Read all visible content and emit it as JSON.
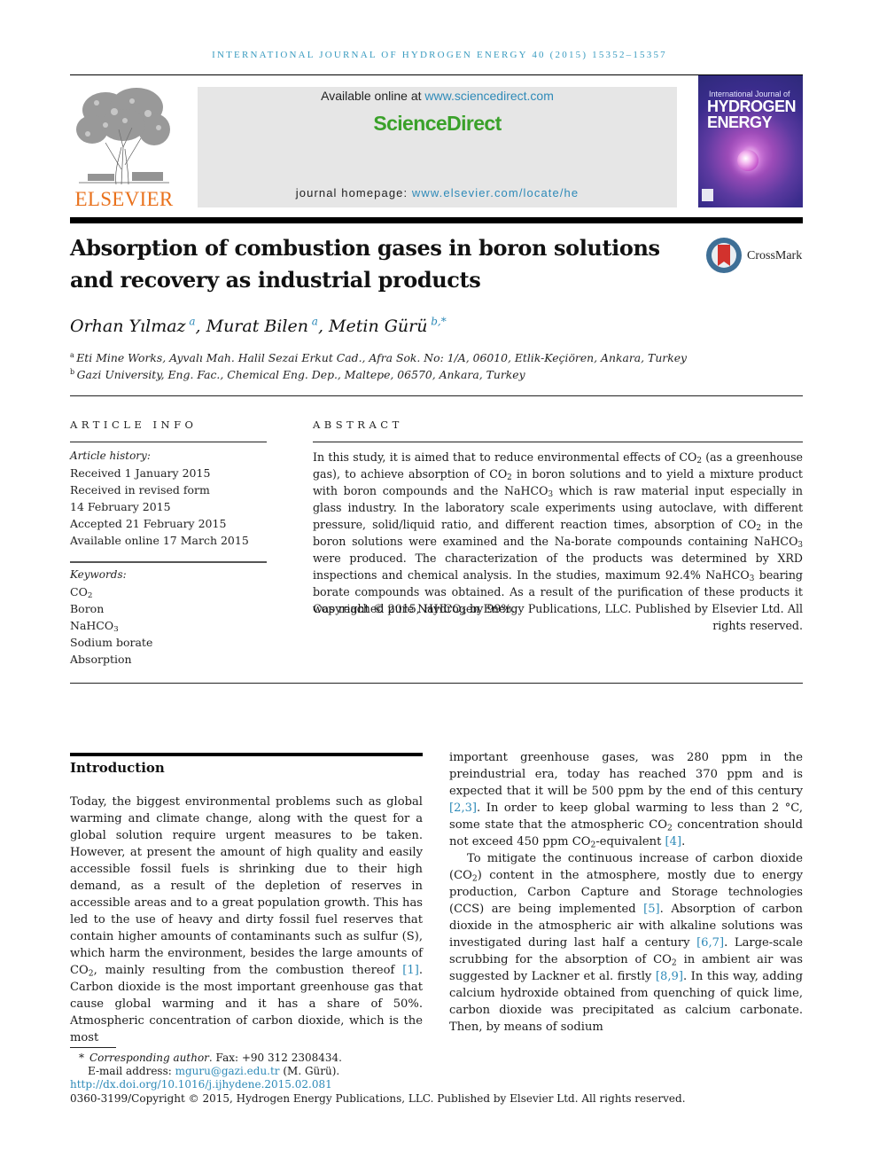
{
  "running_header": "INTERNATIONAL JOURNAL OF HYDROGEN ENERGY 40 (2015) 15352–15357",
  "publisher": {
    "wordmark": "ELSEVIER",
    "logo_icon": "elsevier-tree-icon"
  },
  "sciencedirect_banner": {
    "available_prefix": "Available online at ",
    "available_link": "www.sciencedirect.com",
    "wordmark": "ScienceDirect",
    "homepage_prefix": "journal homepage: ",
    "homepage_link": "www.elsevier.com/locate/he"
  },
  "journal_cover": {
    "title_top": "International Journal of",
    "title_line1": "HYDROGEN",
    "title_line2": "ENERGY"
  },
  "crossmark": {
    "label": "CrossMark",
    "icon": "crossmark-icon"
  },
  "article": {
    "title_line1": "Absorption of combustion gases in boron solutions",
    "title_line2": "and recovery as industrial products",
    "authors": [
      {
        "name": "Orhan Yılmaz",
        "sup": "a"
      },
      {
        "name": "Murat Bilen",
        "sup": "a"
      },
      {
        "name": "Metin Gürü",
        "sup": "b,*"
      }
    ],
    "author_separator": ", ",
    "affiliations": [
      {
        "key": "a",
        "text": "Eti Mine Works, Ayvalı Mah. Halil Sezai Erkut Cad., Afra Sok. No: 1/A, 06010, Etlik-Keçiören, Ankara, Turkey"
      },
      {
        "key": "b",
        "text": "Gazi University, Eng. Fac., Chemical Eng. Dep., Maltepe, 06570, Ankara, Turkey"
      }
    ]
  },
  "article_info": {
    "heading": "ARTICLE INFO",
    "history_label": "Article history:",
    "history": [
      "Received 1 January 2015",
      "Received in revised form",
      "14 February 2015",
      "Accepted 21 February 2015",
      "Available online 17 March 2015"
    ],
    "keywords_label": "Keywords:",
    "keywords": [
      {
        "base": "CO",
        "sub": "2",
        "rest": ""
      },
      {
        "base": "Boron",
        "sub": "",
        "rest": ""
      },
      {
        "base": "NaHCO",
        "sub": "3",
        "rest": ""
      },
      {
        "base": "Sodium borate",
        "sub": "",
        "rest": ""
      },
      {
        "base": "Absorption",
        "sub": "",
        "rest": ""
      }
    ]
  },
  "abstract": {
    "heading": "ABSTRACT",
    "segments": [
      {
        "t": "In this study, it is aimed that to reduce environmental effects of CO"
      },
      {
        "sub": "2"
      },
      {
        "t": " (as a greenhouse gas), to achieve absorption of CO"
      },
      {
        "sub": "2"
      },
      {
        "t": " in boron solutions and to yield a mixture product with boron compounds and the NaHCO"
      },
      {
        "sub": "3"
      },
      {
        "t": " which is raw material input especially in glass industry. In the laboratory scale experiments using autoclave, with different pressure, solid/liquid ratio, and different reaction times, absorption of CO"
      },
      {
        "sub": "2"
      },
      {
        "t": " in the boron solutions were examined and the Na-borate compounds containing NaHCO"
      },
      {
        "sub": "3"
      },
      {
        "t": " were produced. The characterization of the products was determined by XRD inspections and chemical analysis. In the studies, maximum 92.4% NaHCO"
      },
      {
        "sub": "3"
      },
      {
        "t": " bearing borate compounds was obtained. As a result of the purification of these products it was reached pure NaHCO"
      },
      {
        "sub": "3"
      },
      {
        "t": " by 99%."
      }
    ],
    "copyright": "Copyright © 2015, Hydrogen Energy Publications, LLC. Published by Elsevier Ltd. All rights reserved."
  },
  "introduction": {
    "heading": "Introduction",
    "left_column": [
      {
        "t": "Today, the biggest environmental problems such as global warming and climate change, along with the quest for a global solution require urgent measures to be taken. However, at present the amount of high quality and easily accessible fossil fuels is shrinking due to their high demand, as a result of the depletion of reserves in accessible areas and to a great population growth. This has led to the use of heavy and dirty fossil fuel reserves that contain higher amounts of contaminants such as sulfur (S), which harm the environment, besides the large amounts of CO"
      },
      {
        "sub": "2"
      },
      {
        "t": ", mainly resulting from the combustion thereof "
      },
      {
        "ref": "[1]"
      },
      {
        "t": ". Carbon dioxide is the most important greenhouse gas that cause global warming and it has a share of 50%. Atmospheric concentration of carbon dioxide, which is the most"
      }
    ],
    "right_column_p1": [
      {
        "t": "important greenhouse gases, was 280 ppm in the preindustrial era, today has reached 370 ppm and is expected that it will be 500 ppm by the end of this century "
      },
      {
        "ref": "[2,3]"
      },
      {
        "t": ". In order to keep global warming to less than 2 °C, some state that the atmospheric CO"
      },
      {
        "sub": "2"
      },
      {
        "t": " concentration should not exceed 450 ppm CO"
      },
      {
        "sub": "2"
      },
      {
        "t": "-equivalent "
      },
      {
        "ref": "[4]"
      },
      {
        "t": "."
      }
    ],
    "right_column_p2": [
      {
        "t": "To mitigate the continuous increase of carbon dioxide (CO"
      },
      {
        "sub": "2"
      },
      {
        "t": ") content in the atmosphere, mostly due to energy production, Carbon Capture and Storage technologies (CCS) are being implemented "
      },
      {
        "ref": "[5]"
      },
      {
        "t": ". Absorption of carbon dioxide in the atmospheric air with alkaline solutions was investigated during last half a century "
      },
      {
        "ref": "[6,7]"
      },
      {
        "t": ". Large-scale scrubbing for the absorption of CO"
      },
      {
        "sub": "2"
      },
      {
        "t": " in ambient air was suggested by Lackner et al. firstly "
      },
      {
        "ref": "[8,9]"
      },
      {
        "t": ". In this way, adding calcium hydroxide obtained from quenching of quick lime, carbon dioxide was precipitated as calcium carbonate. Then, by means of sodium"
      }
    ]
  },
  "footnotes": {
    "corresponding_label": "Corresponding author",
    "corresponding_rest": ". Fax: +90 312 2308434.",
    "email_label": "E-mail address: ",
    "email": "mguru@gazi.edu.tr",
    "email_owner": " (M. Gürü).",
    "doi": "http://dx.doi.org/10.1016/j.ijhydene.2015.02.081",
    "issn_copyright": "0360-3199/Copyright © 2015, Hydrogen Energy Publications, LLC. Published by Elsevier Ltd. All rights reserved."
  },
  "colors": {
    "link": "#2e8ab8",
    "elsevier_orange": "#e9711c",
    "sciencedirect_green": "#3aa12a",
    "banner_gray": "#e6e6e6"
  }
}
